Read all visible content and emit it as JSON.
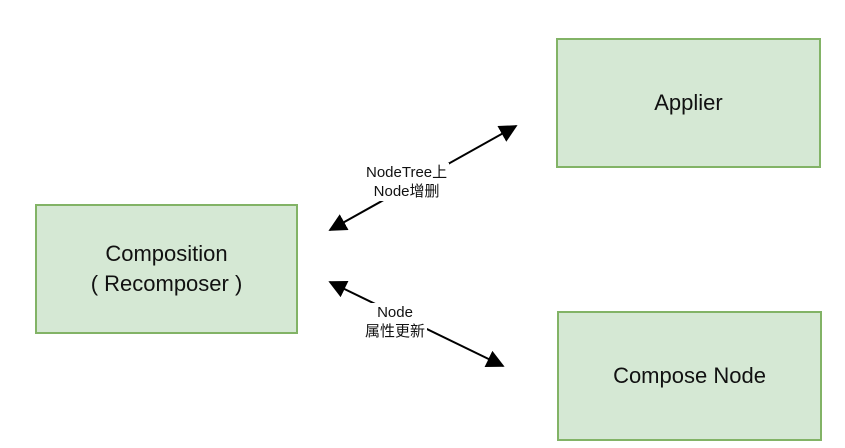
{
  "diagram": {
    "nodes": {
      "composition": {
        "line1": "Composition",
        "line2": "( Recomposer )"
      },
      "applier": {
        "label": "Applier"
      },
      "compose_node": {
        "label": "Compose Node"
      }
    },
    "edges": {
      "top": {
        "line1": "NodeTree上",
        "line2": "Node增删",
        "direction": "bidirectional"
      },
      "bottom": {
        "line1": "Node",
        "line2": "属性更新",
        "direction": "bidirectional"
      }
    },
    "colors": {
      "box_fill": "#d5e8d4",
      "box_border": "#82b366",
      "arrow": "#000000"
    }
  }
}
